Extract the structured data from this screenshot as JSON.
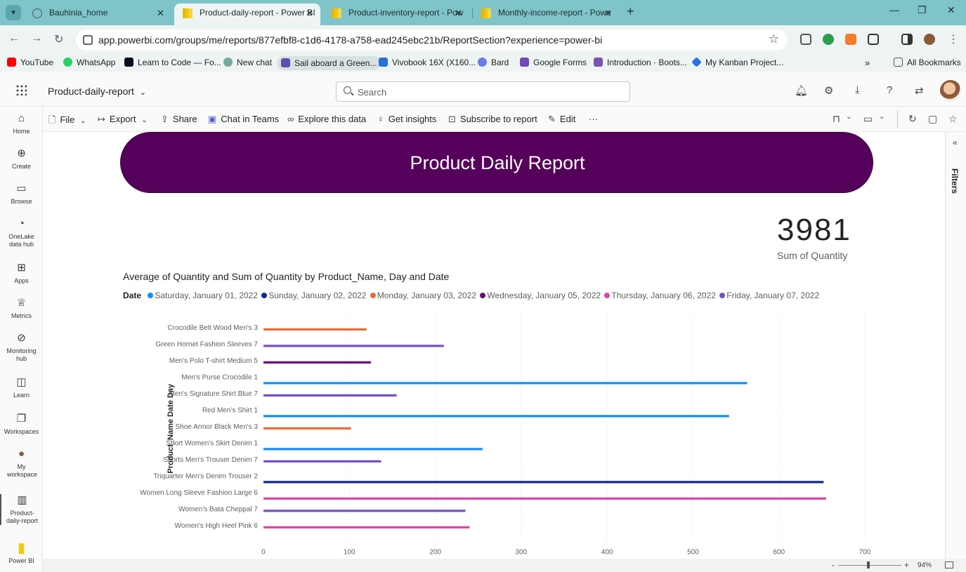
{
  "browser": {
    "tabs": [
      {
        "title": "Bauhinia_home",
        "active": false
      },
      {
        "title": "Product-daily-report - Power BI",
        "active": true
      },
      {
        "title": "Product-inventory-report - Pow",
        "active": false
      },
      {
        "title": "Monthly-income-report - Powe",
        "active": false
      }
    ],
    "url": "app.powerbi.com/groups/me/reports/877efbf8-c1d6-4178-a758-ead245ebc21b/ReportSection?experience=power-bi",
    "bookmarks": [
      {
        "label": "YouTube",
        "color": "#ff0000"
      },
      {
        "label": "WhatsApp",
        "color": "#25d366"
      },
      {
        "label": "Learn to Code — Fo...",
        "color": "#0a0a23"
      },
      {
        "label": "New chat",
        "color": "#74aa9c"
      },
      {
        "label": "Sail aboard a Green...",
        "color": "#5c4db1"
      },
      {
        "label": "Vivobook 16X (X160...",
        "color": "#2a6fdb"
      },
      {
        "label": "Bard",
        "color": "#6b7ce8"
      },
      {
        "label": "Google Forms",
        "color": "#7248b9"
      },
      {
        "label": "Introduction · Boots...",
        "color": "#7952b3"
      },
      {
        "label": "My Kanban Project...",
        "color": "#2f6fe4"
      }
    ],
    "more_bookmarks": "»",
    "all_bookmarks": "All Bookmarks"
  },
  "header": {
    "report_name": "Product-daily-report",
    "search_placeholder": "Search"
  },
  "leftnav": [
    {
      "label": "Home",
      "icon": "home-icon",
      "glyph": "⌂"
    },
    {
      "label": "Create",
      "icon": "plus-circle-icon",
      "glyph": "⊕"
    },
    {
      "label": "Browse",
      "icon": "folder-icon",
      "glyph": "▭"
    },
    {
      "label": "OneLake data hub",
      "icon": "onelake-icon",
      "glyph": "◔"
    },
    {
      "label": "Apps",
      "icon": "apps-icon",
      "glyph": "⊞"
    },
    {
      "label": "Metrics",
      "icon": "trophy-icon",
      "glyph": "♕"
    },
    {
      "label": "Monitoring hub",
      "icon": "monitor-icon",
      "glyph": "⊘"
    },
    {
      "label": "Learn",
      "icon": "book-icon",
      "glyph": "◫"
    },
    {
      "label": "Workspaces",
      "icon": "workspaces-icon",
      "glyph": "❐"
    },
    {
      "label": "My workspace",
      "icon": "user-avatar-icon",
      "glyph": "●"
    },
    {
      "label": "Product-daily-report",
      "icon": "report-icon",
      "glyph": "▥"
    },
    {
      "label": "Power BI",
      "icon": "powerbi-logo-icon",
      "glyph": "▮"
    }
  ],
  "toolbar": {
    "file": "File",
    "export": "Export",
    "share": "Share",
    "chat": "Chat in Teams",
    "explore": "Explore this data",
    "insights": "Get insights",
    "subscribe": "Subscribe to report",
    "edit": "Edit",
    "more": "···"
  },
  "filters": {
    "label": "Filters",
    "collapse": "«"
  },
  "report": {
    "banner_title": "Product Daily Report",
    "kpi_value": "3981",
    "kpi_label": "Sum of Quantity"
  },
  "chart_data": {
    "type": "bar",
    "orientation": "horizontal",
    "title": "Average of Quantity and Sum of Quantity by Product_Name, Day and Date",
    "xlabel": "Average of Quantity",
    "ylabel": "Product_Name Date Day",
    "xlim": [
      0,
      700
    ],
    "xticks": [
      0,
      100,
      200,
      300,
      400,
      500,
      600,
      700
    ],
    "grid": true,
    "legend_title": "Date",
    "legend_placement": "top-left",
    "series": [
      {
        "name": "Saturday, January 01, 2022",
        "color": "#118dff"
      },
      {
        "name": "Sunday, January 02, 2022",
        "color": "#12239e"
      },
      {
        "name": "Monday, January 03, 2022",
        "color": "#e66c37"
      },
      {
        "name": "Wednesday, January 05, 2022",
        "color": "#6b007b"
      },
      {
        "name": "Thursday, January 06, 2022",
        "color": "#e044a7"
      },
      {
        "name": "Friday, January 07, 2022",
        "color": "#744ec2"
      }
    ],
    "categories": [
      {
        "label": "Crocodile Belt Wood Men's 3",
        "bars": [
          {
            "series": 2,
            "value": 120
          }
        ]
      },
      {
        "label": "Green Hornet Fashion Sleeves 7",
        "bars": [
          {
            "series": 5,
            "value": 210
          }
        ]
      },
      {
        "label": "Men's Polo T-shirt Medium 5",
        "bars": [
          {
            "series": 3,
            "value": 125
          }
        ]
      },
      {
        "label": "Men's Purse Crocodile 1",
        "bars": [
          {
            "series": 0,
            "value": 563
          }
        ]
      },
      {
        "label": "Men's Signature Shirt Blue 7",
        "bars": [
          {
            "series": 5,
            "value": 155
          }
        ]
      },
      {
        "label": "Red Men's Shirt 1",
        "bars": [
          {
            "series": 0,
            "value": 542
          }
        ]
      },
      {
        "label": "Shoe Armor Black Men's 3",
        "bars": [
          {
            "series": 2,
            "value": 102
          }
        ]
      },
      {
        "label": "Short Women's Skirt Denim 1",
        "bars": [
          {
            "series": 0,
            "value": 255
          }
        ]
      },
      {
        "label": "Shorts Men's Trouser Denim 7",
        "bars": [
          {
            "series": 5,
            "value": 137
          }
        ]
      },
      {
        "label": "Triquarter Men's Denim Trouser 2",
        "bars": [
          {
            "series": 1,
            "value": 652
          }
        ]
      },
      {
        "label": "Women Long Sleeve Fashion Large 6",
        "bars": [
          {
            "series": 4,
            "value": 655
          }
        ]
      },
      {
        "label": "Women's Bata Cheppal 7",
        "bars": [
          {
            "series": 5,
            "value": 235
          }
        ]
      },
      {
        "label": "Women's High Heel Pink 6",
        "bars": [
          {
            "series": 4,
            "value": 240
          }
        ]
      }
    ]
  },
  "status": {
    "zoom_minus": "-",
    "zoom_plus": "+",
    "zoom": "94%"
  }
}
